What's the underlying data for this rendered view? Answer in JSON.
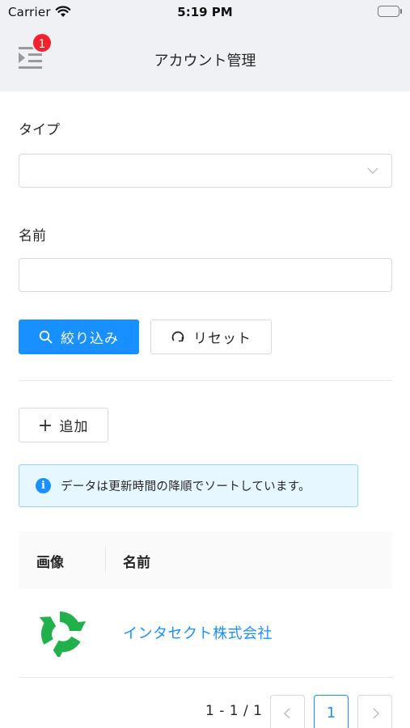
{
  "status_bar": {
    "carrier": "Carrier",
    "time": "5:19 PM"
  },
  "header": {
    "title": "アカウント管理",
    "menu_badge": "1",
    "menu_icon": "menu-fold-icon"
  },
  "filters": {
    "type_label": "タイプ",
    "type_value": "",
    "name_label": "名前",
    "name_value": "",
    "search_button": "絞り込み",
    "reset_button": "リセット"
  },
  "actions": {
    "add_button": "追加"
  },
  "alert": {
    "message": "データは更新時間の降順でソートしています。"
  },
  "table": {
    "columns": [
      "画像",
      "名前"
    ],
    "rows": [
      {
        "image": "company-logo",
        "name": "インタセクト株式会社"
      }
    ]
  },
  "pagination": {
    "summary": "1 - 1 / 1",
    "prev": "<",
    "current": "1",
    "next": ">"
  },
  "colors": {
    "primary": "#1890ff",
    "badge": "#f5222d",
    "header_bg": "#f0f1f4",
    "logo_green": "#21b04b"
  }
}
